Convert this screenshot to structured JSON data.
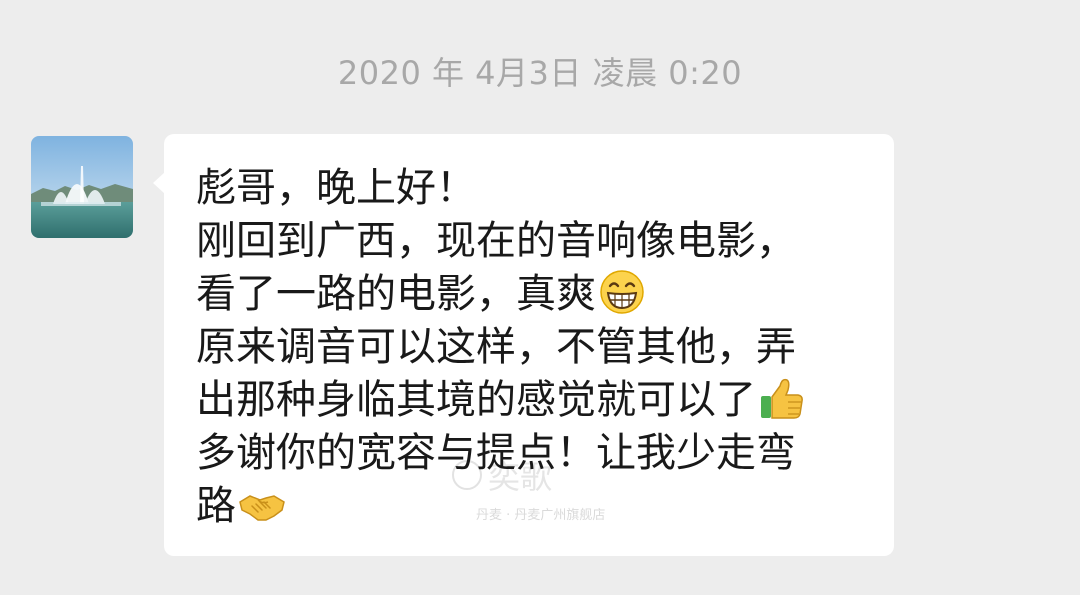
{
  "timestamp": "2020 年 4月3日 凌晨 0:20",
  "avatar": {
    "icon": "fountain-photo-avatar"
  },
  "message": {
    "lines": [
      "彪哥，晚上好！",
      "刚回到广西，现在的音响像电影，",
      "看了一路的电影，真爽",
      "原来调音可以这样，不管其他，弄",
      "出那种身临其境的感觉就可以了",
      "多谢你的宽容与提点！让我少走弯",
      "路"
    ],
    "emojis": {
      "line3": "grinning-face-emoji",
      "line5": "thumbs-up-emoji",
      "line7": "handshake-emoji"
    }
  },
  "watermark": {
    "brand": "奕歌",
    "subtext": "丹麦 · 丹麦广州旗舰店"
  }
}
